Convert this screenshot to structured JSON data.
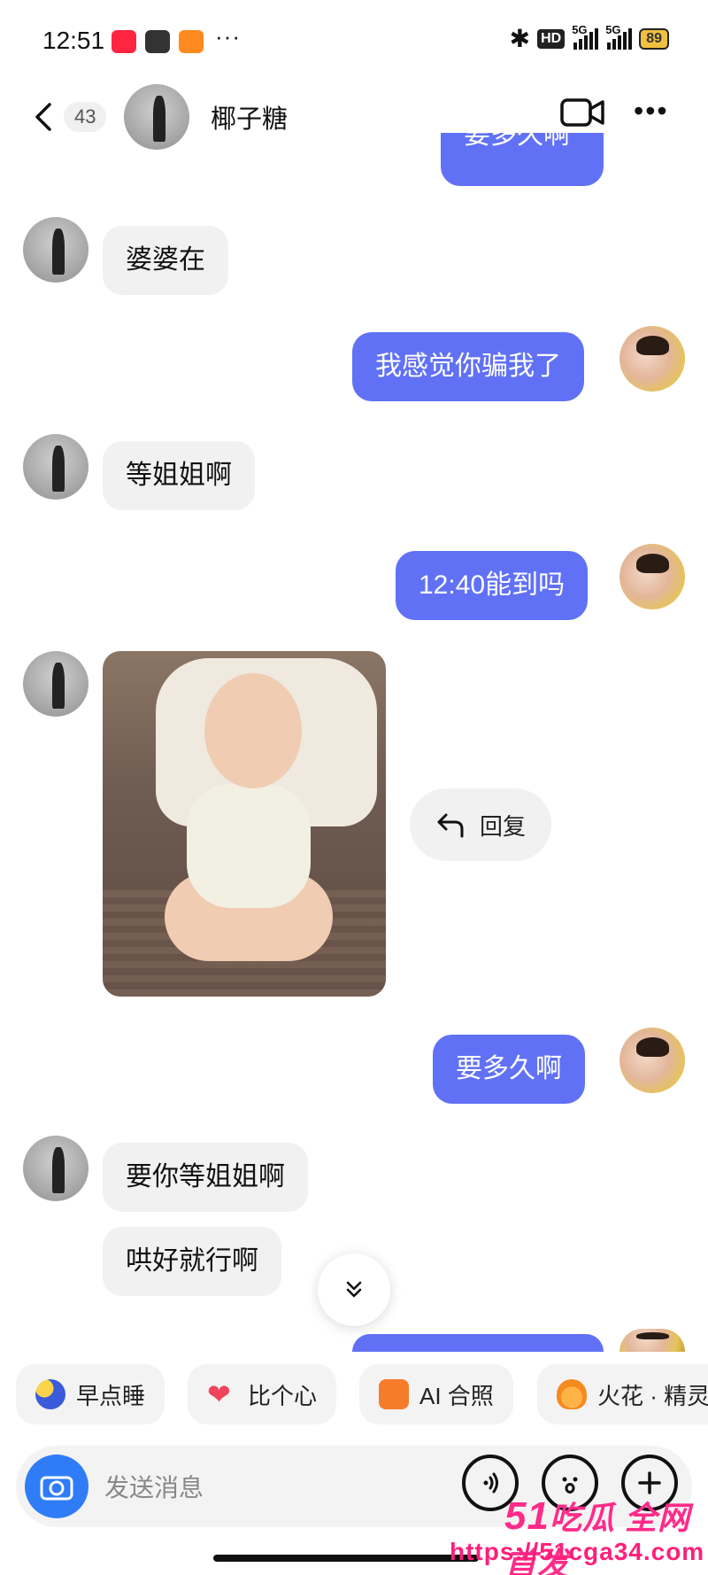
{
  "status_bar": {
    "time": "12:51",
    "app_icons": [
      "xiaohongshu-icon",
      "mi-icon",
      "taobao-icon"
    ],
    "more": "···",
    "hd_label": "HD",
    "sim1": "5G",
    "sim2": "5G",
    "battery": "89"
  },
  "header": {
    "unread_count": "43",
    "contact_name": "椰子糖",
    "icons": [
      "back-chevron-icon",
      "video-call-icon",
      "more-dots-icon"
    ]
  },
  "messages": [
    {
      "side": "out",
      "text": "要多久啊",
      "partial": true
    },
    {
      "side": "in",
      "text": "婆婆在"
    },
    {
      "side": "out",
      "text": "我感觉你骗我了"
    },
    {
      "side": "in",
      "text": "等姐姐啊"
    },
    {
      "side": "out",
      "text": "12:40能到吗"
    },
    {
      "side": "in",
      "type": "image",
      "description": "baby-photo"
    },
    {
      "side": "out",
      "text": "要多久啊"
    },
    {
      "side": "in",
      "text": "要你等姐姐啊"
    },
    {
      "side": "in",
      "text": "哄好就行啊"
    }
  ],
  "reply_action": {
    "label": "回复"
  },
  "quick_actions": [
    {
      "label": "早点睡",
      "icon": "moon-icon",
      "color": "#3b5bdb"
    },
    {
      "label": "比个心",
      "icon": "heart-icon",
      "color": "#f0445a"
    },
    {
      "label": "AI 合照",
      "icon": "ai-photo-icon",
      "color": "#f57c2b"
    },
    {
      "label": "火花 · 精灵",
      "icon": "spark-icon",
      "color": "#f58a1f"
    }
  ],
  "input": {
    "placeholder": "发送消息"
  },
  "watermark": {
    "logo_num": "51",
    "logo_text": "吃瓜 全网首发",
    "url": "https://51cga34.com"
  },
  "colors": {
    "outgoing_bubble": "#6171f5",
    "incoming_bubble": "#f1f1f1",
    "camera_button": "#2f7cf6",
    "watermark": "#ff2b8a"
  }
}
